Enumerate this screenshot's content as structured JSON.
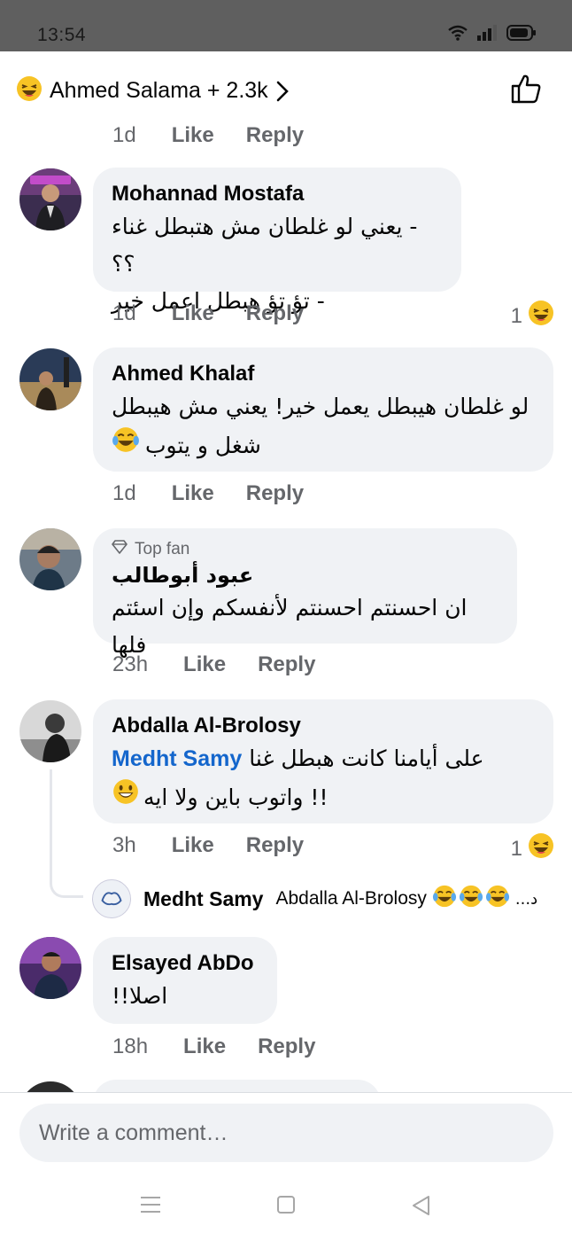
{
  "status_bar": {
    "time": "13:54"
  },
  "header": {
    "reactors_label": "Ahmed Salama + 2.3k"
  },
  "feed": {
    "partial_meta": {
      "time": "1d",
      "like": "Like",
      "reply": "Reply"
    },
    "comments": [
      {
        "author": "Mohannad Mostafa",
        "lines": [
          "- يعني لو غلطان مش هتبطل غناء ؟؟",
          "- تؤ تؤ هبطل اعمل خير"
        ],
        "time": "1d",
        "like": "Like",
        "reply": "Reply",
        "reaction_count": "1"
      },
      {
        "author": "Ahmed Khalaf",
        "lines": [
          "لو غلطان هيبطل يعمل خير! يعني مش هيبطل",
          "شغل و يتوب"
        ],
        "time": "1d",
        "like": "Like",
        "reply": "Reply"
      },
      {
        "badge": "Top fan",
        "author": "عبود أبوطالب",
        "lines": [
          "ان احسنتم احسنتم لأنفسكم وإن اسئتم فلها"
        ],
        "time": "23h",
        "like": "Like",
        "reply": "Reply"
      },
      {
        "author": "Abdalla Al-Brolosy",
        "mention": "Medht Samy",
        "lines": [
          "على أيامنا كانت هبطل غنا",
          "!! واتوب باين ولا ايه"
        ],
        "time": "3h",
        "like": "Like",
        "reply": "Reply",
        "reaction_count": "1",
        "reply_preview": {
          "author": "Medht Samy",
          "text": "Abdalla Al-Brolosy",
          "trail": "...د"
        }
      },
      {
        "author": "Elsayed AbDo",
        "lines": [
          "اصلا!!"
        ],
        "time": "18h",
        "like": "Like",
        "reply": "Reply"
      }
    ]
  },
  "composer": {
    "placeholder": "Write a comment…"
  },
  "colors": {
    "bubble": "#f0f2f5",
    "mention": "#1466cc",
    "meta": "#65676b",
    "status_bar": "#5f5f5f"
  }
}
